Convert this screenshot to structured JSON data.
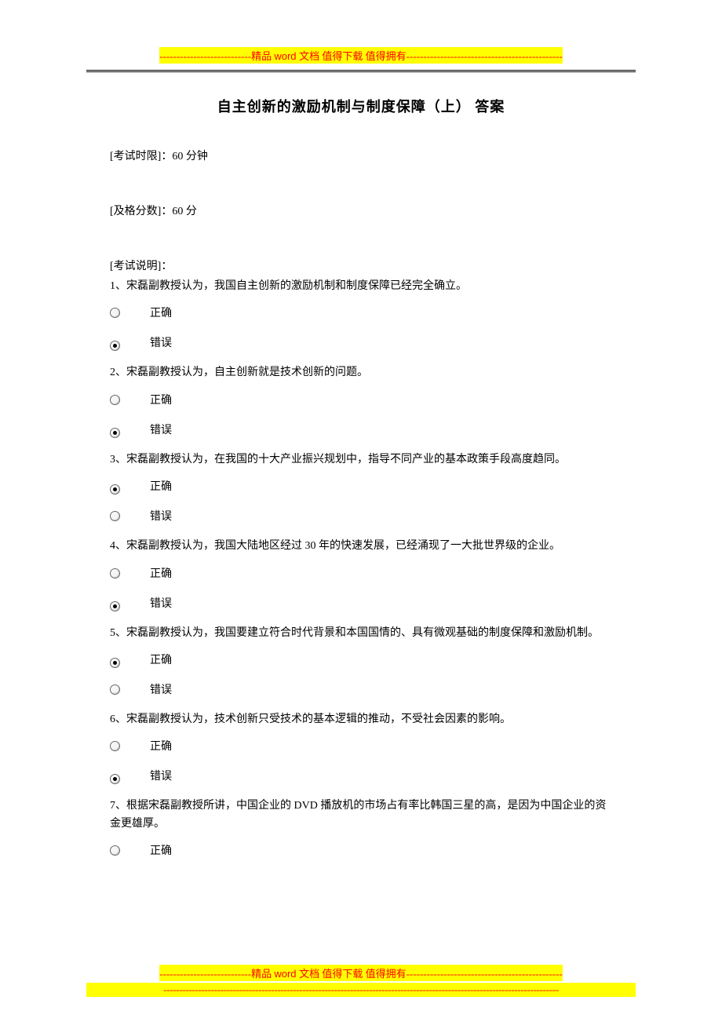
{
  "banner": {
    "dashes_left": "---------------------------",
    "text_prefix": "精品 ",
    "word": "word ",
    "text_suffix": "文档  值得下载  值得拥有",
    "dashes_right": "----------------------------------------------",
    "bottom_dashes": "-----------------------------------------------------------------------------------------------------------------------------"
  },
  "title": "自主创新的激励机制与制度保障（上）    答案",
  "meta": {
    "time_limit": "[考试时限]：60 分钟",
    "pass_score": "[及格分数]：60 分",
    "notes": "[考试说明]："
  },
  "options": {
    "correct": "正确",
    "wrong": "错误"
  },
  "questions": [
    {
      "text": "1、宋磊副教授认为，我国自主创新的激励机制和制度保障已经完全确立。",
      "selected": "wrong"
    },
    {
      "text": "2、宋磊副教授认为，自主创新就是技术创新的问题。",
      "selected": "wrong"
    },
    {
      "text": "3、宋磊副教授认为，在我国的十大产业振兴规划中，指导不同产业的基本政策手段高度趋同。",
      "selected": "correct"
    },
    {
      "text": "4、宋磊副教授认为，我国大陆地区经过 30 年的快速发展，已经涌现了一大批世界级的企业。",
      "selected": "wrong"
    },
    {
      "text": "5、宋磊副教授认为，我国要建立符合时代背景和本国国情的、具有微观基础的制度保障和激励机制。",
      "selected": "correct"
    },
    {
      "text": "6、宋磊副教授认为，技术创新只受技术的基本逻辑的推动，不受社会因素的影响。",
      "selected": "wrong"
    },
    {
      "text": "7、根据宋磊副教授所讲，中国企业的 DVD 播放机的市场占有率比韩国三星的高，是因为中国企业的资金更雄厚。",
      "selected": null,
      "partial": true
    }
  ]
}
